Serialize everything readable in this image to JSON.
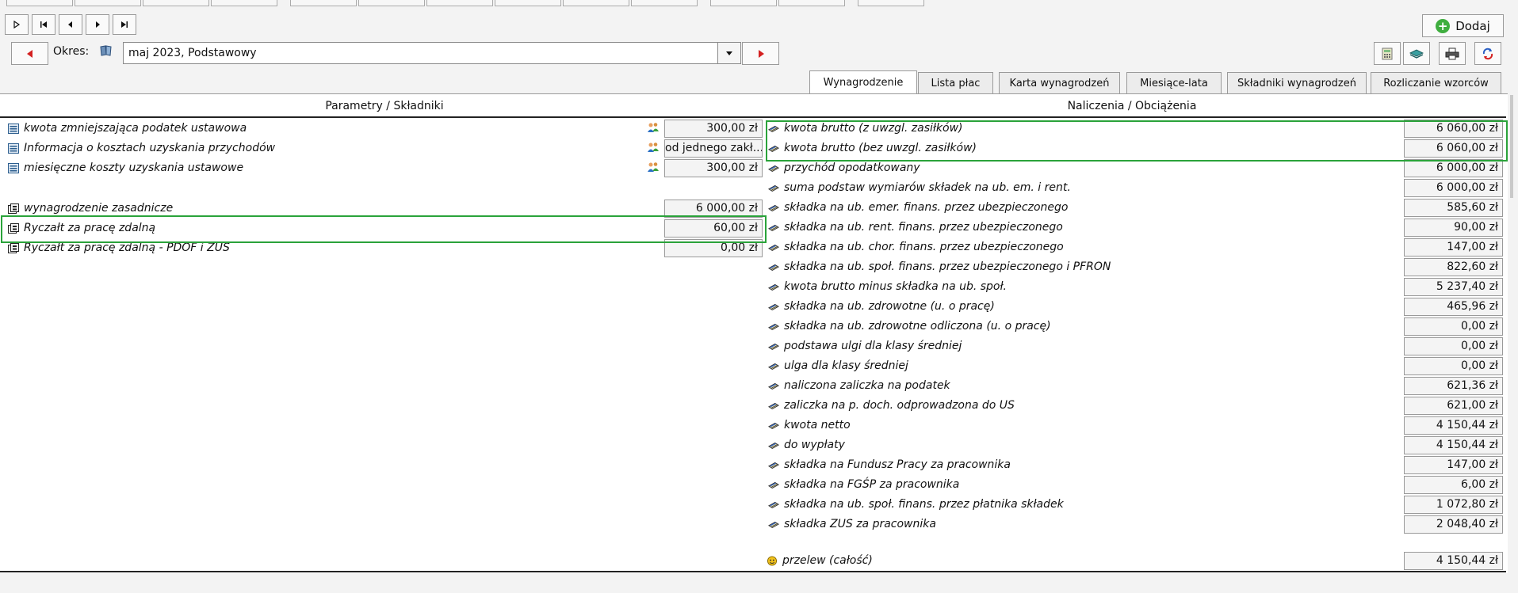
{
  "toolbar": {
    "dodaj_label": "Dodaj",
    "okres_label": "Okres:",
    "okres_value": "maj 2023, Podstawowy"
  },
  "tabs": [
    {
      "label": "Wynagrodzenie",
      "active": true
    },
    {
      "label": "Lista płac"
    },
    {
      "label": "Karta wynagrodzeń"
    },
    {
      "label": "Miesiące-lata"
    },
    {
      "label": "Składniki wynagrodzeń"
    },
    {
      "label": "Rozliczanie wzorców"
    }
  ],
  "left": {
    "header": "Parametry / Składniki",
    "rows": [
      {
        "label": "kwota zmniejszająca podatek ustawowa",
        "value": "300,00 zł"
      },
      {
        "label": "Informacja o kosztach uzyskania przychodów",
        "value": "od jednego zakł..."
      },
      {
        "label": "miesięczne koszty uzyskania ustawowe",
        "value": "300,00 zł"
      },
      {
        "label": "wynagrodzenie zasadnicze",
        "value": "6 000,00 zł"
      },
      {
        "label": "Ryczałt za pracę zdalną",
        "value": "60,00 zł"
      },
      {
        "label": "Ryczałt za pracę zdalną - PDOF i ZUS",
        "value": "0,00 zł"
      }
    ]
  },
  "right": {
    "header": "Naliczenia / Obciążenia",
    "rows": [
      {
        "label": "kwota brutto (z uwzgl. zasiłków)",
        "value": "6 060,00 zł"
      },
      {
        "label": "kwota brutto (bez uwzgl. zasiłków)",
        "value": "6 060,00 zł"
      },
      {
        "label": "przychód opodatkowany",
        "value": "6 000,00 zł"
      },
      {
        "label": "suma podstaw wymiarów składek na ub. em. i rent.",
        "value": "6 000,00 zł"
      },
      {
        "label": "składka na ub. emer. finans. przez ubezpieczonego",
        "value": "585,60 zł"
      },
      {
        "label": "składka na ub. rent. finans. przez ubezpieczonego",
        "value": "90,00 zł"
      },
      {
        "label": "składka na ub. chor. finans. przez ubezpieczonego",
        "value": "147,00 zł"
      },
      {
        "label": "składka na ub. społ. finans. przez ubezpieczonego i PFRON",
        "value": "822,60 zł"
      },
      {
        "label": "kwota brutto minus składka na ub. społ.",
        "value": "5 237,40 zł"
      },
      {
        "label": "składka na ub. zdrowotne (u. o pracę)",
        "value": "465,96 zł"
      },
      {
        "label": "składka na ub. zdrowotne odliczona (u. o pracę)",
        "value": "0,00 zł"
      },
      {
        "label": "podstawa ulgi dla klasy średniej",
        "value": "0,00 zł"
      },
      {
        "label": "ulga dla klasy średniej",
        "value": "0,00 zł"
      },
      {
        "label": "naliczona zaliczka na podatek",
        "value": "621,36 zł"
      },
      {
        "label": "zaliczka na p. doch. odprowadzona do US",
        "value": "621,00 zł"
      },
      {
        "label": "kwota netto",
        "value": "4 150,44 zł"
      },
      {
        "label": "do wypłaty",
        "value": "4 150,44 zł"
      },
      {
        "label": "składka na Fundusz Pracy za pracownika",
        "value": "147,00 zł"
      },
      {
        "label": "składka na FGŚP za pracownika",
        "value": "6,00 zł"
      },
      {
        "label": "składka na ub. społ. finans. przez płatnika składek",
        "value": "1 072,80 zł"
      },
      {
        "label": "składka ZUS za pracownika",
        "value": "2 048,40 zł"
      }
    ],
    "total": {
      "label": "przelew (całość)",
      "value": "4 150,44 zł"
    }
  }
}
